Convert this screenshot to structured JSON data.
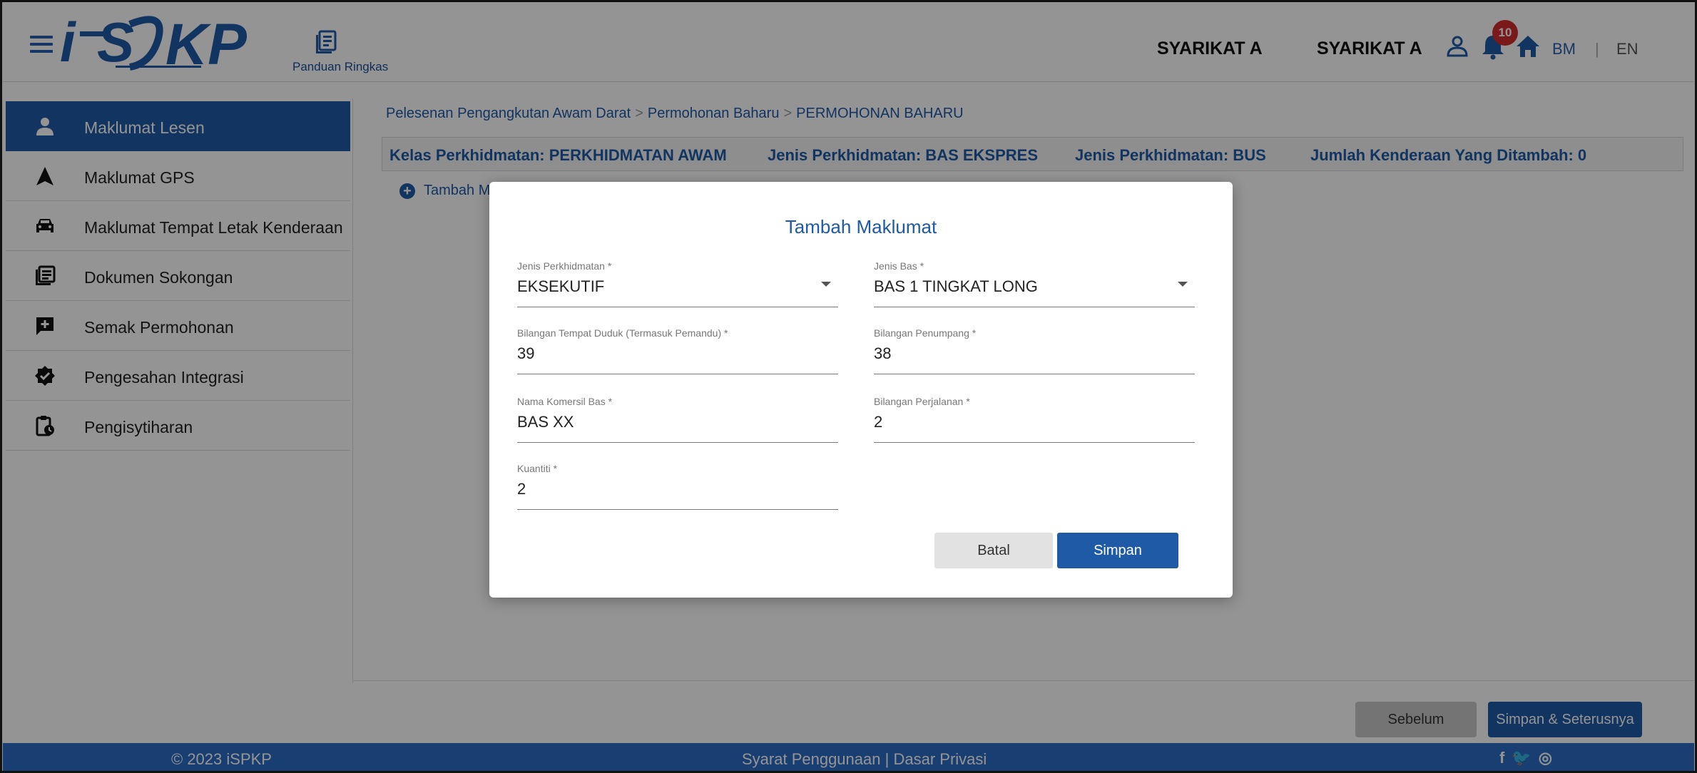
{
  "header": {
    "guide_label": "Panduan Ringkas",
    "company_name_1": "SYARIKAT A",
    "company_name_2": "SYARIKAT A",
    "notification_count": "10",
    "lang_bm": "BM",
    "lang_separator": "|",
    "lang_en": "EN",
    "logo_text": "iSPKP",
    "brand_color": "#1f5aa6"
  },
  "sidebar": {
    "items": [
      {
        "label": "Maklumat Lesen",
        "icon": "person-icon",
        "active": true
      },
      {
        "label": "Maklumat GPS",
        "icon": "navigation-arrow-icon",
        "active": false
      },
      {
        "label": "Maklumat Tempat Letak Kenderaan",
        "icon": "car-icon",
        "active": false
      },
      {
        "label": "Dokumen Sokongan",
        "icon": "document-library-icon",
        "active": false
      },
      {
        "label": "Semak Permohonan",
        "icon": "feedback-plus-icon",
        "active": false
      },
      {
        "label": "Pengesahan Integrasi",
        "icon": "verified-badge-icon",
        "active": false
      },
      {
        "label": "Pengisytiharan",
        "icon": "clipboard-clock-icon",
        "active": false
      }
    ]
  },
  "breadcrumb": {
    "item1": "Pelesenan Pengangkutan Awam Darat",
    "item2": "Permohonan Baharu",
    "current": "PERMOHONAN BAHARU",
    "separator": ">"
  },
  "info_bar": {
    "kelas": "Kelas Perkhidmatan: PERKHIDMATAN AWAM",
    "jenis1": "Jenis Perkhidmatan: BAS EKSPRES",
    "jenis2": "Jenis Perkhidmatan: BUS",
    "jumlah": "Jumlah Kenderaan Yang Ditambah: 0"
  },
  "add_link": {
    "label": "Tambah M"
  },
  "nav_buttons": {
    "previous": "Sebelum",
    "next": "Simpan & Seterusnya"
  },
  "footer": {
    "copyright": "© 2023 iSPKP",
    "terms": "Syarat Penggunaan",
    "separator": "|",
    "privacy": "Dasar Privasi",
    "social": [
      "f",
      "🐦",
      "◎"
    ]
  },
  "modal": {
    "title": "Tambah Maklumat",
    "fields": [
      {
        "label": "Jenis Perkhidmatan *",
        "value": "EKSEKUTIF",
        "type": "select"
      },
      {
        "label": "Jenis Bas *",
        "value": "BAS 1 TINGKAT LONG",
        "type": "select"
      },
      {
        "label": "Bilangan Tempat Duduk (Termasuk Pemandu) *",
        "value": "39",
        "type": "text"
      },
      {
        "label": "Bilangan Penumpang *",
        "value": "38",
        "type": "text"
      },
      {
        "label": "Nama Komersil Bas *",
        "value": "BAS XX",
        "type": "text"
      },
      {
        "label": "Bilangan Perjalanan *",
        "value": "2",
        "type": "text"
      },
      {
        "label": "Kuantiti *",
        "value": "2",
        "type": "text"
      }
    ],
    "cancel_label": "Batal",
    "save_label": "Simpan"
  }
}
